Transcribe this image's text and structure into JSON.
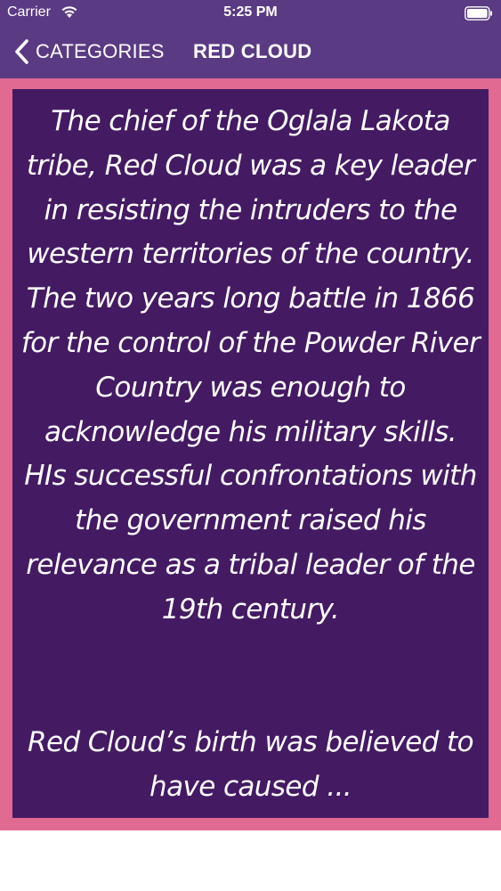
{
  "status_bar": {
    "carrier": "Carrier",
    "time": "5:25 PM"
  },
  "nav": {
    "back_label": "CATEGORIES",
    "title": "RED CLOUD"
  },
  "article": {
    "text": "The chief of the Oglala Lakota tribe, Red Cloud was a key leader in resisting the intruders to the western territories of the country. The two years long battle in 1866 for the control of the Powder River Country was enough to acknowledge his military skills. HIs successful confrontations with the government raised his relevance as a tribal leader of the 19th century.\n\n\nRed Cloud’s birth was believed to have caused ..."
  },
  "colors": {
    "nav_background": "#5b3a84",
    "frame": "#e06a92",
    "content_background": "#441a63",
    "text": "#ffffff"
  },
  "icons": [
    "wifi-icon",
    "battery-icon",
    "chevron-left-icon"
  ]
}
